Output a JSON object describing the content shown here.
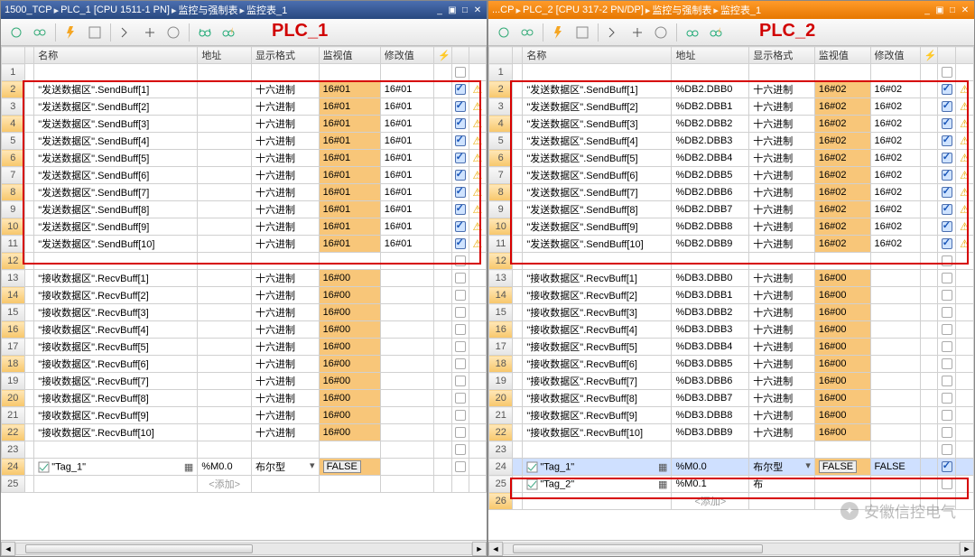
{
  "left": {
    "plc_label": "PLC_1",
    "breadcrumb": [
      "1500_TCP",
      "PLC_1 [CPU 1511-1 PN]",
      "监控与强制表",
      "监控表_1"
    ],
    "columns": {
      "name": "名称",
      "addr": "地址",
      "fmt": "显示格式",
      "mon": "监视值",
      "mod": "修改值"
    },
    "rows": [
      {
        "n": 1,
        "name": "",
        "addr": "",
        "fmt": "",
        "mon": "",
        "mod": "",
        "chk": "empty",
        "warn": false
      },
      {
        "n": 2,
        "name": "\"发送数据区\".SendBuff[1]",
        "addr": "",
        "fmt": "十六进制",
        "mon": "16#01",
        "mod": "16#01",
        "chk": "on",
        "warn": true,
        "hl": true
      },
      {
        "n": 3,
        "name": "\"发送数据区\".SendBuff[2]",
        "addr": "",
        "fmt": "十六进制",
        "mon": "16#01",
        "mod": "16#01",
        "chk": "on",
        "warn": true
      },
      {
        "n": 4,
        "name": "\"发送数据区\".SendBuff[3]",
        "addr": "",
        "fmt": "十六进制",
        "mon": "16#01",
        "mod": "16#01",
        "chk": "on",
        "warn": true,
        "hl": true
      },
      {
        "n": 5,
        "name": "\"发送数据区\".SendBuff[4]",
        "addr": "",
        "fmt": "十六进制",
        "mon": "16#01",
        "mod": "16#01",
        "chk": "on",
        "warn": true
      },
      {
        "n": 6,
        "name": "\"发送数据区\".SendBuff[5]",
        "addr": "",
        "fmt": "十六进制",
        "mon": "16#01",
        "mod": "16#01",
        "chk": "on",
        "warn": true,
        "hl": true
      },
      {
        "n": 7,
        "name": "\"发送数据区\".SendBuff[6]",
        "addr": "",
        "fmt": "十六进制",
        "mon": "16#01",
        "mod": "16#01",
        "chk": "on",
        "warn": true
      },
      {
        "n": 8,
        "name": "\"发送数据区\".SendBuff[7]",
        "addr": "",
        "fmt": "十六进制",
        "mon": "16#01",
        "mod": "16#01",
        "chk": "on",
        "warn": true,
        "hl": true
      },
      {
        "n": 9,
        "name": "\"发送数据区\".SendBuff[8]",
        "addr": "",
        "fmt": "十六进制",
        "mon": "16#01",
        "mod": "16#01",
        "chk": "on",
        "warn": true
      },
      {
        "n": 10,
        "name": "\"发送数据区\".SendBuff[9]",
        "addr": "",
        "fmt": "十六进制",
        "mon": "16#01",
        "mod": "16#01",
        "chk": "on",
        "warn": true,
        "hl": true
      },
      {
        "n": 11,
        "name": "\"发送数据区\".SendBuff[10]",
        "addr": "",
        "fmt": "十六进制",
        "mon": "16#01",
        "mod": "16#01",
        "chk": "on",
        "warn": true
      },
      {
        "n": 12,
        "name": "",
        "addr": "",
        "fmt": "",
        "mon": "",
        "mod": "",
        "chk": "empty",
        "warn": false,
        "hl": true
      },
      {
        "n": 13,
        "name": "\"接收数据区\".RecvBuff[1]",
        "addr": "",
        "fmt": "十六进制",
        "mon": "16#00",
        "mod": "",
        "chk": "empty",
        "warn": false
      },
      {
        "n": 14,
        "name": "\"接收数据区\".RecvBuff[2]",
        "addr": "",
        "fmt": "十六进制",
        "mon": "16#00",
        "mod": "",
        "chk": "empty",
        "warn": false,
        "hl": true
      },
      {
        "n": 15,
        "name": "\"接收数据区\".RecvBuff[3]",
        "addr": "",
        "fmt": "十六进制",
        "mon": "16#00",
        "mod": "",
        "chk": "empty",
        "warn": false
      },
      {
        "n": 16,
        "name": "\"接收数据区\".RecvBuff[4]",
        "addr": "",
        "fmt": "十六进制",
        "mon": "16#00",
        "mod": "",
        "chk": "empty",
        "warn": false,
        "hl": true
      },
      {
        "n": 17,
        "name": "\"接收数据区\".RecvBuff[5]",
        "addr": "",
        "fmt": "十六进制",
        "mon": "16#00",
        "mod": "",
        "chk": "empty",
        "warn": false
      },
      {
        "n": 18,
        "name": "\"接收数据区\".RecvBuff[6]",
        "addr": "",
        "fmt": "十六进制",
        "mon": "16#00",
        "mod": "",
        "chk": "empty",
        "warn": false,
        "hl": true
      },
      {
        "n": 19,
        "name": "\"接收数据区\".RecvBuff[7]",
        "addr": "",
        "fmt": "十六进制",
        "mon": "16#00",
        "mod": "",
        "chk": "empty",
        "warn": false
      },
      {
        "n": 20,
        "name": "\"接收数据区\".RecvBuff[8]",
        "addr": "",
        "fmt": "十六进制",
        "mon": "16#00",
        "mod": "",
        "chk": "empty",
        "warn": false,
        "hl": true
      },
      {
        "n": 21,
        "name": "\"接收数据区\".RecvBuff[9]",
        "addr": "",
        "fmt": "十六进制",
        "mon": "16#00",
        "mod": "",
        "chk": "empty",
        "warn": false
      },
      {
        "n": 22,
        "name": "\"接收数据区\".RecvBuff[10]",
        "addr": "",
        "fmt": "十六进制",
        "mon": "16#00",
        "mod": "",
        "chk": "empty",
        "warn": false,
        "hl": true
      },
      {
        "n": 23,
        "name": "",
        "addr": "",
        "fmt": "",
        "mon": "",
        "mod": "",
        "chk": "empty",
        "warn": false
      },
      {
        "n": 24,
        "name": "\"Tag_1\"",
        "addr": "%M0.0",
        "fmt": "布尔型",
        "mon": "FALSE",
        "mod": "",
        "chk": "empty",
        "warn": false,
        "tag": true,
        "hl": true,
        "falsebox": true,
        "dd": true
      },
      {
        "n": 25,
        "name": "",
        "addr": "<添加>",
        "fmt": "",
        "mon": "",
        "mod": "",
        "chk": "",
        "warn": false,
        "add": true
      }
    ]
  },
  "right": {
    "plc_label": "PLC_2",
    "breadcrumb": [
      "...CP",
      "PLC_2 [CPU 317-2 PN/DP]",
      "监控与强制表",
      "监控表_1"
    ],
    "columns": {
      "name": "名称",
      "addr": "地址",
      "fmt": "显示格式",
      "mon": "监视值",
      "mod": "修改值"
    },
    "rows": [
      {
        "n": 1,
        "name": "",
        "addr": "",
        "fmt": "",
        "mon": "",
        "mod": "",
        "chk": "empty",
        "warn": false
      },
      {
        "n": 2,
        "name": "\"发送数据区\".SendBuff[1]",
        "addr": "%DB2.DBB0",
        "fmt": "十六进制",
        "mon": "16#02",
        "mod": "16#02",
        "chk": "on",
        "warn": true,
        "hl": true
      },
      {
        "n": 3,
        "name": "\"发送数据区\".SendBuff[2]",
        "addr": "%DB2.DBB1",
        "fmt": "十六进制",
        "mon": "16#02",
        "mod": "16#02",
        "chk": "on",
        "warn": true
      },
      {
        "n": 4,
        "name": "\"发送数据区\".SendBuff[3]",
        "addr": "%DB2.DBB2",
        "fmt": "十六进制",
        "mon": "16#02",
        "mod": "16#02",
        "chk": "on",
        "warn": true,
        "hl": true
      },
      {
        "n": 5,
        "name": "\"发送数据区\".SendBuff[4]",
        "addr": "%DB2.DBB3",
        "fmt": "十六进制",
        "mon": "16#02",
        "mod": "16#02",
        "chk": "on",
        "warn": true
      },
      {
        "n": 6,
        "name": "\"发送数据区\".SendBuff[5]",
        "addr": "%DB2.DBB4",
        "fmt": "十六进制",
        "mon": "16#02",
        "mod": "16#02",
        "chk": "on",
        "warn": true,
        "hl": true
      },
      {
        "n": 7,
        "name": "\"发送数据区\".SendBuff[6]",
        "addr": "%DB2.DBB5",
        "fmt": "十六进制",
        "mon": "16#02",
        "mod": "16#02",
        "chk": "on",
        "warn": true
      },
      {
        "n": 8,
        "name": "\"发送数据区\".SendBuff[7]",
        "addr": "%DB2.DBB6",
        "fmt": "十六进制",
        "mon": "16#02",
        "mod": "16#02",
        "chk": "on",
        "warn": true,
        "hl": true
      },
      {
        "n": 9,
        "name": "\"发送数据区\".SendBuff[8]",
        "addr": "%DB2.DBB7",
        "fmt": "十六进制",
        "mon": "16#02",
        "mod": "16#02",
        "chk": "on",
        "warn": true
      },
      {
        "n": 10,
        "name": "\"发送数据区\".SendBuff[9]",
        "addr": "%DB2.DBB8",
        "fmt": "十六进制",
        "mon": "16#02",
        "mod": "16#02",
        "chk": "on",
        "warn": true,
        "hl": true
      },
      {
        "n": 11,
        "name": "\"发送数据区\".SendBuff[10]",
        "addr": "%DB2.DBB9",
        "fmt": "十六进制",
        "mon": "16#02",
        "mod": "16#02",
        "chk": "on",
        "warn": true
      },
      {
        "n": 12,
        "name": "",
        "addr": "",
        "fmt": "",
        "mon": "",
        "mod": "",
        "chk": "empty",
        "warn": false,
        "hl": true
      },
      {
        "n": 13,
        "name": "\"接收数据区\".RecvBuff[1]",
        "addr": "%DB3.DBB0",
        "fmt": "十六进制",
        "mon": "16#00",
        "mod": "",
        "chk": "empty",
        "warn": false
      },
      {
        "n": 14,
        "name": "\"接收数据区\".RecvBuff[2]",
        "addr": "%DB3.DBB1",
        "fmt": "十六进制",
        "mon": "16#00",
        "mod": "",
        "chk": "empty",
        "warn": false,
        "hl": true
      },
      {
        "n": 15,
        "name": "\"接收数据区\".RecvBuff[3]",
        "addr": "%DB3.DBB2",
        "fmt": "十六进制",
        "mon": "16#00",
        "mod": "",
        "chk": "empty",
        "warn": false
      },
      {
        "n": 16,
        "name": "\"接收数据区\".RecvBuff[4]",
        "addr": "%DB3.DBB3",
        "fmt": "十六进制",
        "mon": "16#00",
        "mod": "",
        "chk": "empty",
        "warn": false,
        "hl": true
      },
      {
        "n": 17,
        "name": "\"接收数据区\".RecvBuff[5]",
        "addr": "%DB3.DBB4",
        "fmt": "十六进制",
        "mon": "16#00",
        "mod": "",
        "chk": "empty",
        "warn": false
      },
      {
        "n": 18,
        "name": "\"接收数据区\".RecvBuff[6]",
        "addr": "%DB3.DBB5",
        "fmt": "十六进制",
        "mon": "16#00",
        "mod": "",
        "chk": "empty",
        "warn": false,
        "hl": true
      },
      {
        "n": 19,
        "name": "\"接收数据区\".RecvBuff[7]",
        "addr": "%DB3.DBB6",
        "fmt": "十六进制",
        "mon": "16#00",
        "mod": "",
        "chk": "empty",
        "warn": false
      },
      {
        "n": 20,
        "name": "\"接收数据区\".RecvBuff[8]",
        "addr": "%DB3.DBB7",
        "fmt": "十六进制",
        "mon": "16#00",
        "mod": "",
        "chk": "empty",
        "warn": false,
        "hl": true
      },
      {
        "n": 21,
        "name": "\"接收数据区\".RecvBuff[9]",
        "addr": "%DB3.DBB8",
        "fmt": "十六进制",
        "mon": "16#00",
        "mod": "",
        "chk": "empty",
        "warn": false
      },
      {
        "n": 22,
        "name": "\"接收数据区\".RecvBuff[10]",
        "addr": "%DB3.DBB9",
        "fmt": "十六进制",
        "mon": "16#00",
        "mod": "",
        "chk": "empty",
        "warn": false,
        "hl": true
      },
      {
        "n": 23,
        "name": "",
        "addr": "",
        "fmt": "",
        "mon": "",
        "mod": "",
        "chk": "empty",
        "warn": false
      },
      {
        "n": 24,
        "name": "\"Tag_1\"",
        "addr": "%M0.0",
        "fmt": "布尔型",
        "mon": "FALSE",
        "mod": "FALSE",
        "chk": "on",
        "warn": false,
        "tag": true,
        "sel": true,
        "falsebox": true,
        "dd": true
      },
      {
        "n": 25,
        "name": "\"Tag_2\"",
        "addr": "%M0.1",
        "fmt": "布",
        "mon": "",
        "mod": "",
        "chk": "empty",
        "warn": false,
        "tag": true
      },
      {
        "n": 26,
        "name": "",
        "addr": "<添加>",
        "fmt": "",
        "mon": "",
        "mod": "",
        "chk": "",
        "warn": false,
        "add": true,
        "hl": true
      }
    ]
  },
  "watermark": "安徽信控电气"
}
